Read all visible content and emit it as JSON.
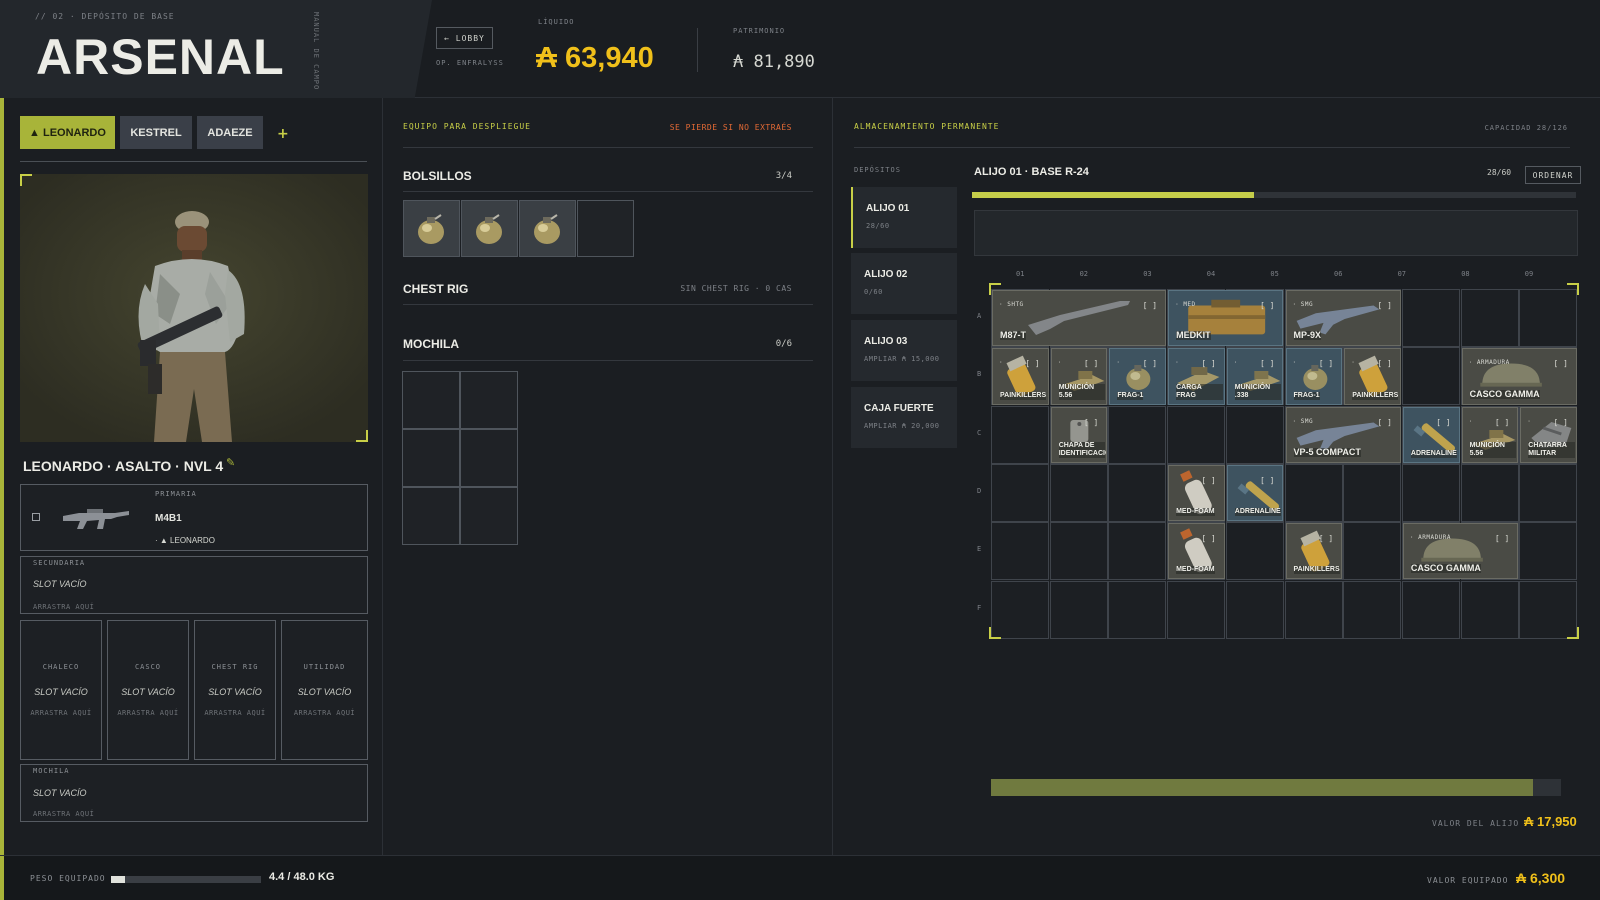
{
  "header": {
    "breadcrumb": "// 02 · DEPÓSITO DE BASE",
    "title": "ARSENAL",
    "manual": "MANUAL DE CAMPO",
    "lobby_button": "← LOBBY",
    "operator": "OP. ENFRALYSS",
    "liquid_label": "LÍQUIDO",
    "liquid_value": "₳ 63,940",
    "patrimony_label": "PATRIMONIO",
    "patrimony_value": "₳ 81,890"
  },
  "tabs": [
    {
      "label": "▲ LEONARDO"
    },
    {
      "label": "KESTREL"
    },
    {
      "label": "ADAEZE"
    }
  ],
  "tab_add": "+",
  "character": {
    "name": "LEONARDO · ASALTO · NVL 4",
    "edit_icon": "pencil-icon"
  },
  "loadout": {
    "primary": {
      "label": "PRIMARIA",
      "weapon": "M4B1",
      "owner": "· ▲ LEONARDO"
    },
    "secondary": {
      "label": "SECUNDARIA",
      "value": "SLOT VACÍO",
      "hint": "ARRASTRA AQUÍ"
    },
    "slots": [
      {
        "label": "CHALECO",
        "value": "SLOT VACÍO",
        "hint": "ARRASTRA AQUÍ"
      },
      {
        "label": "CASCO",
        "value": "SLOT VACÍO",
        "hint": "ARRASTRA AQUÍ"
      },
      {
        "label": "CHEST RIG",
        "value": "SLOT VACÍO",
        "hint": "ARRASTRA AQUÍ"
      },
      {
        "label": "UTILIDAD",
        "value": "SLOT VACÍO",
        "hint": "ARRASTRA AQUÍ"
      }
    ],
    "backpack": {
      "label": "MOCHILA",
      "value": "SLOT VACÍO",
      "hint": "ARRASTRA AQUÍ"
    }
  },
  "deploy": {
    "title": "EQUIPO PARA DESPLIEGUE",
    "warning": "SE PIERDE SI NO EXTRAÉS",
    "pockets": {
      "title": "BOLSILLOS",
      "count": "3/4",
      "filled": 3,
      "total": 4
    },
    "chest_rig": {
      "title": "CHEST RIG",
      "note": "SIN CHEST RIG · 0 CAS"
    },
    "backpack": {
      "title": "MOCHILA",
      "count": "0/6"
    }
  },
  "storage": {
    "title": "ALMACENAMIENTO PERMANENTE",
    "capacity": "CAPACIDAD 28/126",
    "deposits_label": "DEPÓSITOS",
    "stashes": [
      {
        "name": "ALIJO 01",
        "sub": "28/60",
        "active": true
      },
      {
        "name": "ALIJO 02",
        "sub": "0/60",
        "active": false
      },
      {
        "name": "ALIJO 03",
        "sub": "AMPLIAR ₳ 15,000",
        "active": false
      },
      {
        "name": "CAJA FUERTE",
        "sub": "AMPLIAR ₳ 20,000",
        "active": false
      }
    ],
    "current": {
      "title": "ALIJO 01 · BASE R-24",
      "count": "28/60",
      "fill": 0.4667,
      "sort_button": "ORDENAR"
    },
    "columns": [
      "01",
      "02",
      "03",
      "04",
      "05",
      "06",
      "07",
      "08",
      "09"
    ],
    "rows": [
      "A",
      "B",
      "C",
      "D",
      "E",
      "F"
    ],
    "items": [
      {
        "name": "M87-T",
        "tag": "· SHTG",
        "row": 0,
        "col": 0,
        "w": 3,
        "h": 1,
        "blue": false,
        "icon": "shotgun-icon"
      },
      {
        "name": "MEDKIT",
        "tag": "· MED",
        "row": 0,
        "col": 3,
        "w": 2,
        "h": 1,
        "blue": true,
        "icon": "medkit-icon"
      },
      {
        "name": "MP-9X",
        "tag": "· SMG",
        "row": 0,
        "col": 5,
        "w": 2,
        "h": 1,
        "blue": false,
        "icon": "smg-icon"
      },
      {
        "name": "PAINKILLERS",
        "tag": "·",
        "row": 1,
        "col": 0,
        "w": 1,
        "h": 1,
        "blue": false,
        "icon": "pill-bottle-icon"
      },
      {
        "name": "MUNICIÓN 5.56",
        "tag": "·",
        "row": 1,
        "col": 1,
        "w": 1,
        "h": 1,
        "blue": false,
        "icon": "ammo-icon"
      },
      {
        "name": "FRAG-1",
        "tag": "·",
        "row": 1,
        "col": 2,
        "w": 1,
        "h": 1,
        "blue": true,
        "icon": "grenade-icon"
      },
      {
        "name": "CARGA FRAG",
        "tag": "·",
        "row": 1,
        "col": 3,
        "w": 1,
        "h": 1,
        "blue": true,
        "icon": "charge-icon"
      },
      {
        "name": "MUNICIÓN .338",
        "tag": "·",
        "row": 1,
        "col": 4,
        "w": 1,
        "h": 1,
        "blue": true,
        "icon": "ammo-icon"
      },
      {
        "name": "FRAG-1",
        "tag": "·",
        "row": 1,
        "col": 5,
        "w": 1,
        "h": 1,
        "blue": true,
        "icon": "grenade-icon"
      },
      {
        "name": "PAINKILLERS",
        "tag": "·",
        "row": 1,
        "col": 6,
        "w": 1,
        "h": 1,
        "blue": false,
        "icon": "pill-bottle-icon"
      },
      {
        "name": "CASCO GAMMA",
        "tag": "· ARMADURA",
        "row": 1,
        "col": 8,
        "w": 2,
        "h": 1,
        "blue": false,
        "icon": "helmet-icon"
      },
      {
        "name": "CHAPA DE IDENTIFICACIÓN",
        "tag": "",
        "row": 2,
        "col": 1,
        "w": 1,
        "h": 1,
        "blue": false,
        "icon": "dogtag-icon"
      },
      {
        "name": "VP-5 COMPACT",
        "tag": "· SMG",
        "row": 2,
        "col": 5,
        "w": 2,
        "h": 1,
        "blue": false,
        "icon": "smg-icon"
      },
      {
        "name": "ADRENALINE",
        "tag": "",
        "row": 2,
        "col": 7,
        "w": 1,
        "h": 1,
        "blue": true,
        "icon": "syringe-icon"
      },
      {
        "name": "MUNICIÓN 5.56",
        "tag": "·",
        "row": 2,
        "col": 8,
        "w": 1,
        "h": 1,
        "blue": false,
        "icon": "ammo-icon"
      },
      {
        "name": "CHATARRA MILITAR",
        "tag": "·",
        "row": 2,
        "col": 9,
        "w": 1,
        "h": 1,
        "blue": false,
        "icon": "scrap-icon"
      },
      {
        "name": "MED-FOAM",
        "tag": "",
        "row": 3,
        "col": 3,
        "w": 1,
        "h": 1,
        "blue": false,
        "icon": "foam-icon"
      },
      {
        "name": "ADRENALINE",
        "tag": "",
        "row": 3,
        "col": 4,
        "w": 1,
        "h": 1,
        "blue": true,
        "icon": "syringe-icon"
      },
      {
        "name": "MED-FOAM",
        "tag": "",
        "row": 4,
        "col": 3,
        "w": 1,
        "h": 1,
        "blue": false,
        "icon": "foam-icon"
      },
      {
        "name": "PAINKILLERS",
        "tag": "",
        "row": 4,
        "col": 5,
        "w": 1,
        "h": 1,
        "blue": false,
        "icon": "pill-bottle-icon"
      },
      {
        "name": "CASCO GAMMA",
        "tag": "· ARMADURA",
        "row": 4,
        "col": 7,
        "w": 2,
        "h": 1,
        "blue": false,
        "icon": "helmet-icon"
      }
    ],
    "scroll_fill": 0.95,
    "stash_value_label": "VALOR DEL ALIJO",
    "stash_value": "₳ 17,950"
  },
  "footer": {
    "weight_label": "PESO EQUIPADO",
    "weight_value": "4.4 / 48.0 KG",
    "weight_fill": 0.09,
    "equipped_value_label": "VALOR EQUIPADO",
    "equipped_value": "₳ 6,300"
  },
  "colors": {
    "accent": "#a8b439",
    "gold": "#f0c01a",
    "warning": "#e36a35",
    "blue_item": "#3e5360"
  }
}
